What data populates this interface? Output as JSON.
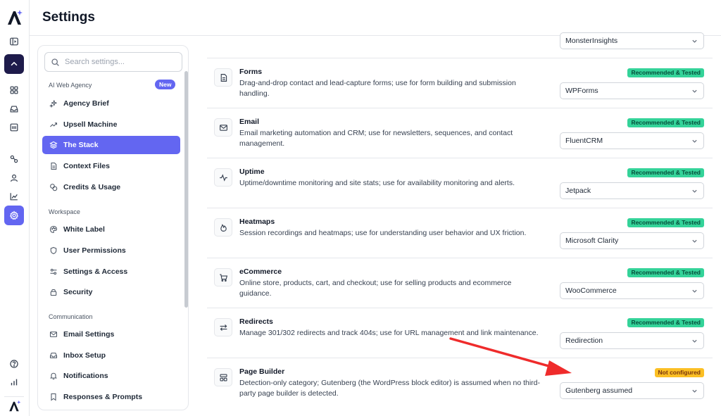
{
  "header": {
    "title": "Settings"
  },
  "search": {
    "placeholder": "Search settings..."
  },
  "sidebar": {
    "sections": [
      {
        "label": "AI Web Agency",
        "badge": "New"
      },
      {
        "label": "Workspace"
      },
      {
        "label": "Communication"
      }
    ],
    "items": [
      {
        "label": "Agency Brief",
        "icon": "sparkles-icon"
      },
      {
        "label": "Upsell Machine",
        "icon": "trend-up-icon"
      },
      {
        "label": "The Stack",
        "icon": "layers-icon",
        "active": true
      },
      {
        "label": "Context Files",
        "icon": "file-icon"
      },
      {
        "label": "Credits & Usage",
        "icon": "coins-icon"
      },
      {
        "label": "White Label",
        "icon": "palette-icon"
      },
      {
        "label": "User Permissions",
        "icon": "shield-icon"
      },
      {
        "label": "Settings & Access",
        "icon": "sliders-icon"
      },
      {
        "label": "Security",
        "icon": "lock-icon"
      },
      {
        "label": "Email Settings",
        "icon": "mail-icon"
      },
      {
        "label": "Inbox Setup",
        "icon": "inbox-icon"
      },
      {
        "label": "Notifications",
        "icon": "bell-icon"
      },
      {
        "label": "Responses & Prompts",
        "icon": "bookmark-icon"
      }
    ]
  },
  "stack": {
    "top_select": "MonsterInsights",
    "rows": [
      {
        "title": "Forms",
        "desc": "Drag-and-drop contact and lead-capture forms; use for form building and submission handling.",
        "status": "Recommended & Tested",
        "value": "WPForms",
        "icon": "file-text-icon"
      },
      {
        "title": "Email",
        "desc": "Email marketing automation and CRM; use for newsletters, sequences, and contact management.",
        "status": "Recommended & Tested",
        "value": "FluentCRM",
        "icon": "mail-icon"
      },
      {
        "title": "Uptime",
        "desc": "Uptime/downtime monitoring and site stats; use for availability monitoring and alerts.",
        "status": "Recommended & Tested",
        "value": "Jetpack",
        "icon": "activity-icon"
      },
      {
        "title": "Heatmaps",
        "desc": "Session recordings and heatmaps; use for understanding user behavior and UX friction.",
        "status": "Recommended & Tested",
        "value": "Microsoft Clarity",
        "icon": "flame-icon"
      },
      {
        "title": "eCommerce",
        "desc": "Online store, products, cart, and checkout; use for selling products and ecommerce guidance.",
        "status": "Recommended & Tested",
        "value": "WooCommerce",
        "icon": "cart-icon"
      },
      {
        "title": "Redirects",
        "desc": "Manage 301/302 redirects and track 404s; use for URL management and link maintenance.",
        "status": "Recommended & Tested",
        "value": "Redirection",
        "icon": "arrows-swap-icon"
      },
      {
        "title": "Page Builder",
        "desc": "Detection-only category; Gutenberg (the WordPress block editor) is assumed when no third-party page builder is detected.",
        "status": "Not configured",
        "value": "Gutenberg assumed",
        "icon": "layout-icon"
      }
    ]
  },
  "colors": {
    "accent": "#6366f1",
    "ok": "#34d399",
    "warn": "#fbbf24",
    "arrow": "#ef2b2b"
  }
}
